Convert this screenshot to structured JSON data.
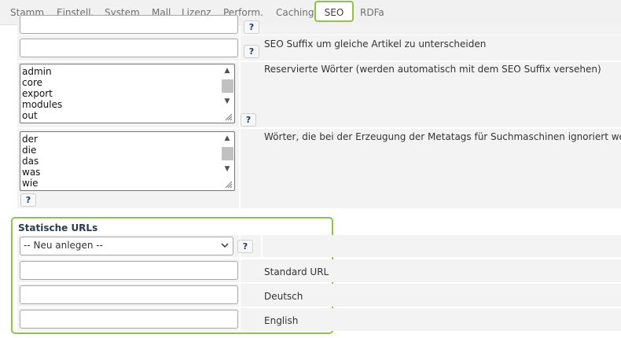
{
  "tabs": [
    {
      "label": "Stamm"
    },
    {
      "label": "Einstell."
    },
    {
      "label": "System"
    },
    {
      "label": "Mall"
    },
    {
      "label": "Lizenz"
    },
    {
      "label": "Perform."
    },
    {
      "label": "Caching"
    },
    {
      "label": "SEO",
      "active": true
    },
    {
      "label": "RDFa"
    }
  ],
  "help_label": "?",
  "seo_suffix": {
    "value": "",
    "label": "SEO Suffix um gleiche Artikel zu unterscheiden"
  },
  "reserved_words": {
    "label": "Reservierte Wörter (werden automatisch mit dem SEO Suffix versehen)",
    "lines": [
      "admin",
      "core",
      "export",
      "modules",
      "out"
    ]
  },
  "ignored_words": {
    "label": "Wörter, die bei der Erzeugung der Metatags für Suchmaschinen ignoriert werden",
    "lines": [
      "der",
      "die",
      "das",
      "was",
      "wie"
    ]
  },
  "static_urls": {
    "title": "Statische URLs",
    "select_value": "-- Neu anlegen --",
    "fields": [
      {
        "label": "Standard URL",
        "value": ""
      },
      {
        "label": "Deutsch",
        "value": ""
      },
      {
        "label": "English",
        "value": ""
      }
    ]
  },
  "colors": {
    "accent": "#8cc63f",
    "cell_bg": "#f3f3f3",
    "help_text": "#1f3b6a"
  }
}
